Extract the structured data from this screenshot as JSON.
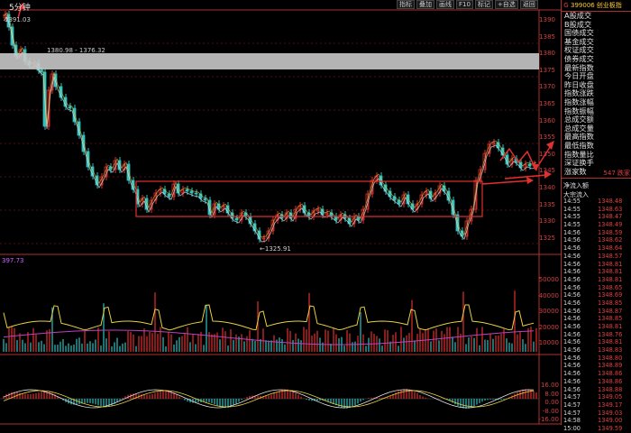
{
  "header": {
    "period": "5分钟"
  },
  "toolbar": [
    "指标",
    "叠加",
    "画线",
    "F10",
    "标记",
    "+自选",
    "返回"
  ],
  "chart_labels": {
    "y_value": "1391.03",
    "range_high": "1380.98 - 1376.32",
    "low": "←1325.91",
    "volume": "397.73"
  },
  "price_axis": [
    "1390",
    "1385",
    "1380",
    "1375",
    "1370",
    "1365",
    "1360",
    "1355",
    "1350",
    "1345",
    "1340",
    "1335",
    "1330",
    "1325"
  ],
  "volume_axis": [
    "50000",
    "40000",
    "30000",
    "20000",
    "10000"
  ],
  "macd_axis": [
    "16.00",
    "8.00",
    "0.00",
    "-8.00",
    "-16.00"
  ],
  "panel": {
    "g_label": "G",
    "code": "399006",
    "name": "创业板指",
    "menu": [
      "A股成交",
      "B股成交",
      "国债成交",
      "基金成交",
      "权证成交",
      "债券成交",
      "最新指数",
      "今日开盘",
      "昨日收盘",
      "指数涨跌",
      "指数涨幅",
      "指数振幅",
      "总成交额",
      "总成交量",
      "最高指数",
      "最低指数",
      "指数量比",
      "深证换手",
      "涨家数"
    ],
    "rising_label": "",
    "falling_label": "547 跌家",
    "net_inflow_label": "净流入额",
    "block_inflow_label": "大宗流入",
    "ticks": [
      {
        "t": "14:55",
        "p": "1348.48"
      },
      {
        "t": "14:55",
        "p": "1348.63"
      },
      {
        "t": "14:55",
        "p": "1348.47"
      },
      {
        "t": "14:55",
        "p": "1348.49"
      },
      {
        "t": "14:56",
        "p": "1348.59"
      },
      {
        "t": "14:56",
        "p": "1348.62"
      },
      {
        "t": "14:56",
        "p": "1348.64"
      },
      {
        "t": "14:56",
        "p": "1348.57"
      },
      {
        "t": "14:56",
        "p": "1348.81"
      },
      {
        "t": "14:56",
        "p": "1348.81"
      },
      {
        "t": "14:56",
        "p": "1348.81"
      },
      {
        "t": "14:56",
        "p": "1348.65"
      },
      {
        "t": "14:56",
        "p": "1348.69"
      },
      {
        "t": "14:56",
        "p": "1348.85"
      },
      {
        "t": "14:56",
        "p": "1348.87"
      },
      {
        "t": "14:56",
        "p": "1348.85"
      },
      {
        "t": "14:56",
        "p": "1348.81"
      },
      {
        "t": "14:56",
        "p": "1348.76"
      },
      {
        "t": "14:56",
        "p": "1348.81"
      },
      {
        "t": "14:56",
        "p": "1348.83"
      },
      {
        "t": "14:56",
        "p": "1348.80"
      },
      {
        "t": "14:56",
        "p": "1348.89"
      },
      {
        "t": "14:56",
        "p": "1348.86"
      },
      {
        "t": "14:56",
        "p": "1348.86"
      },
      {
        "t": "14:56",
        "p": "1348.88"
      },
      {
        "t": "14:57",
        "p": "1349.05"
      },
      {
        "t": "14:57",
        "p": "1349.17"
      },
      {
        "t": "14:57",
        "p": "1349.03"
      },
      {
        "t": "14:58",
        "p": "1349.00"
      },
      {
        "t": "15:00",
        "p": "1349.59"
      }
    ]
  },
  "colors": {
    "up": "#e03030",
    "down": "#30c0c0",
    "box": "#e03030",
    "ma_yellow": "#e8d040",
    "ma_purple": "#c040c0",
    "band": "#c8c8c8"
  }
}
